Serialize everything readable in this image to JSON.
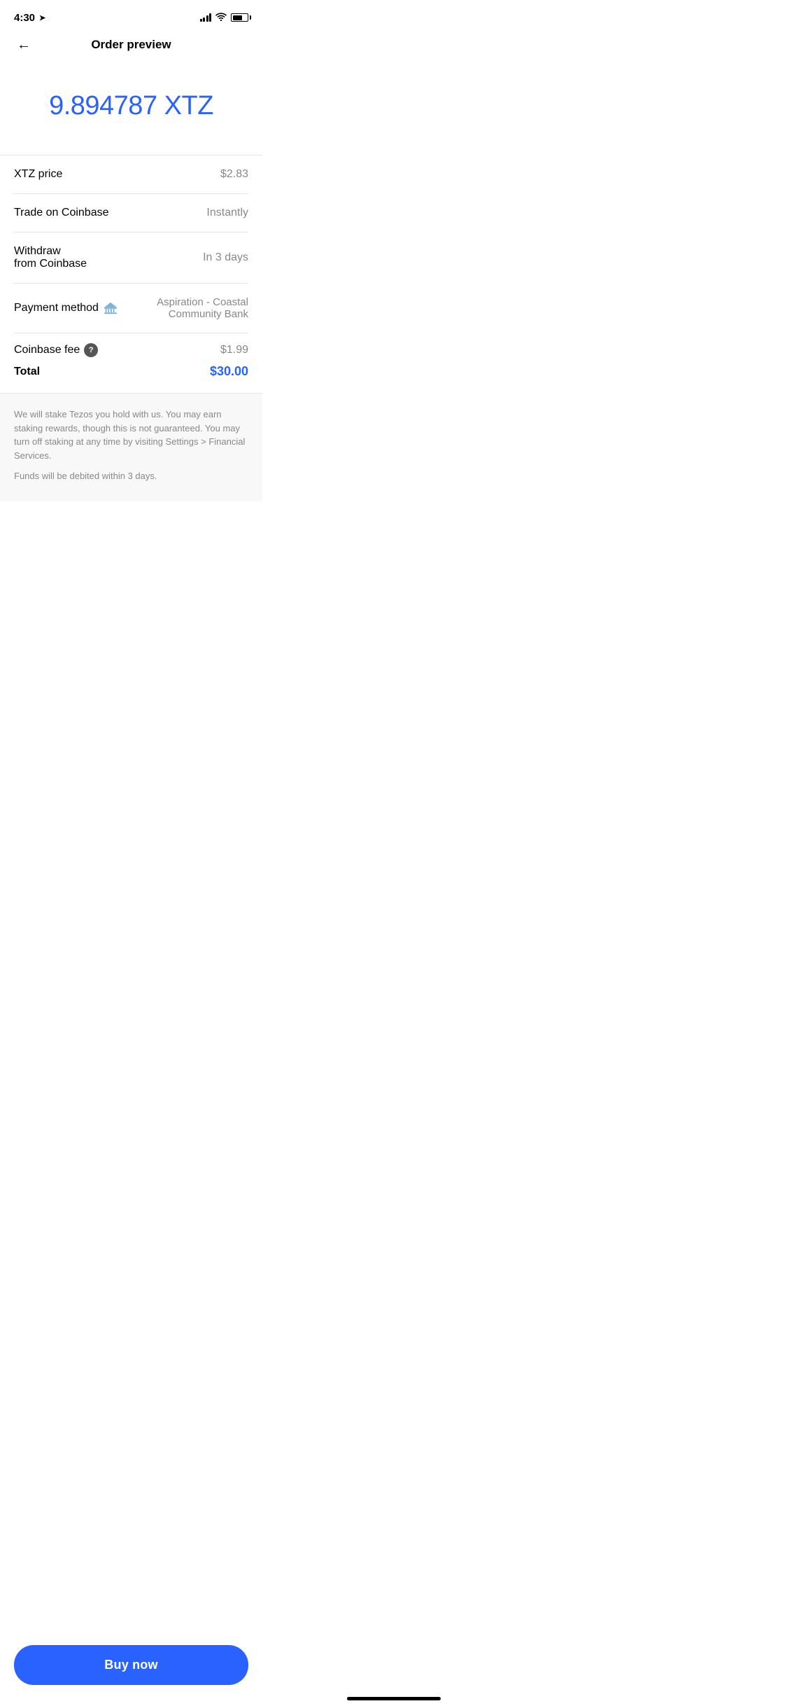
{
  "statusBar": {
    "time": "4:30",
    "locationIcon": "▷"
  },
  "header": {
    "backLabel": "←",
    "title": "Order preview"
  },
  "amount": {
    "value": "9.894787 XTZ",
    "color": "#2962FF"
  },
  "rows": [
    {
      "id": "xtz-price",
      "label": "XTZ price",
      "value": "$2.83",
      "valueStyle": "gray"
    },
    {
      "id": "trade-coinbase",
      "label": "Trade on Coinbase",
      "value": "Instantly",
      "valueStyle": "gray"
    },
    {
      "id": "withdraw-coinbase",
      "label": "Withdraw\nfrom Coinbase",
      "value": "In 3 days",
      "valueStyle": "gray"
    },
    {
      "id": "payment-method",
      "label": "Payment method",
      "bankName": "Aspiration - Coastal Community Bank",
      "valueStyle": "gray"
    }
  ],
  "fee": {
    "label": "Coinbase fee",
    "questionIcon": "?",
    "value": "$1.99"
  },
  "total": {
    "label": "Total",
    "value": "$30.00"
  },
  "disclaimer": {
    "stakingText": "We will stake Tezos you hold with us. You may earn staking rewards, though this is not guaranteed. You may turn off staking at any time by visiting Settings > Financial Services.",
    "fundsText": "Funds will be debited within 3 days."
  },
  "buyButton": {
    "label": "Buy now"
  }
}
